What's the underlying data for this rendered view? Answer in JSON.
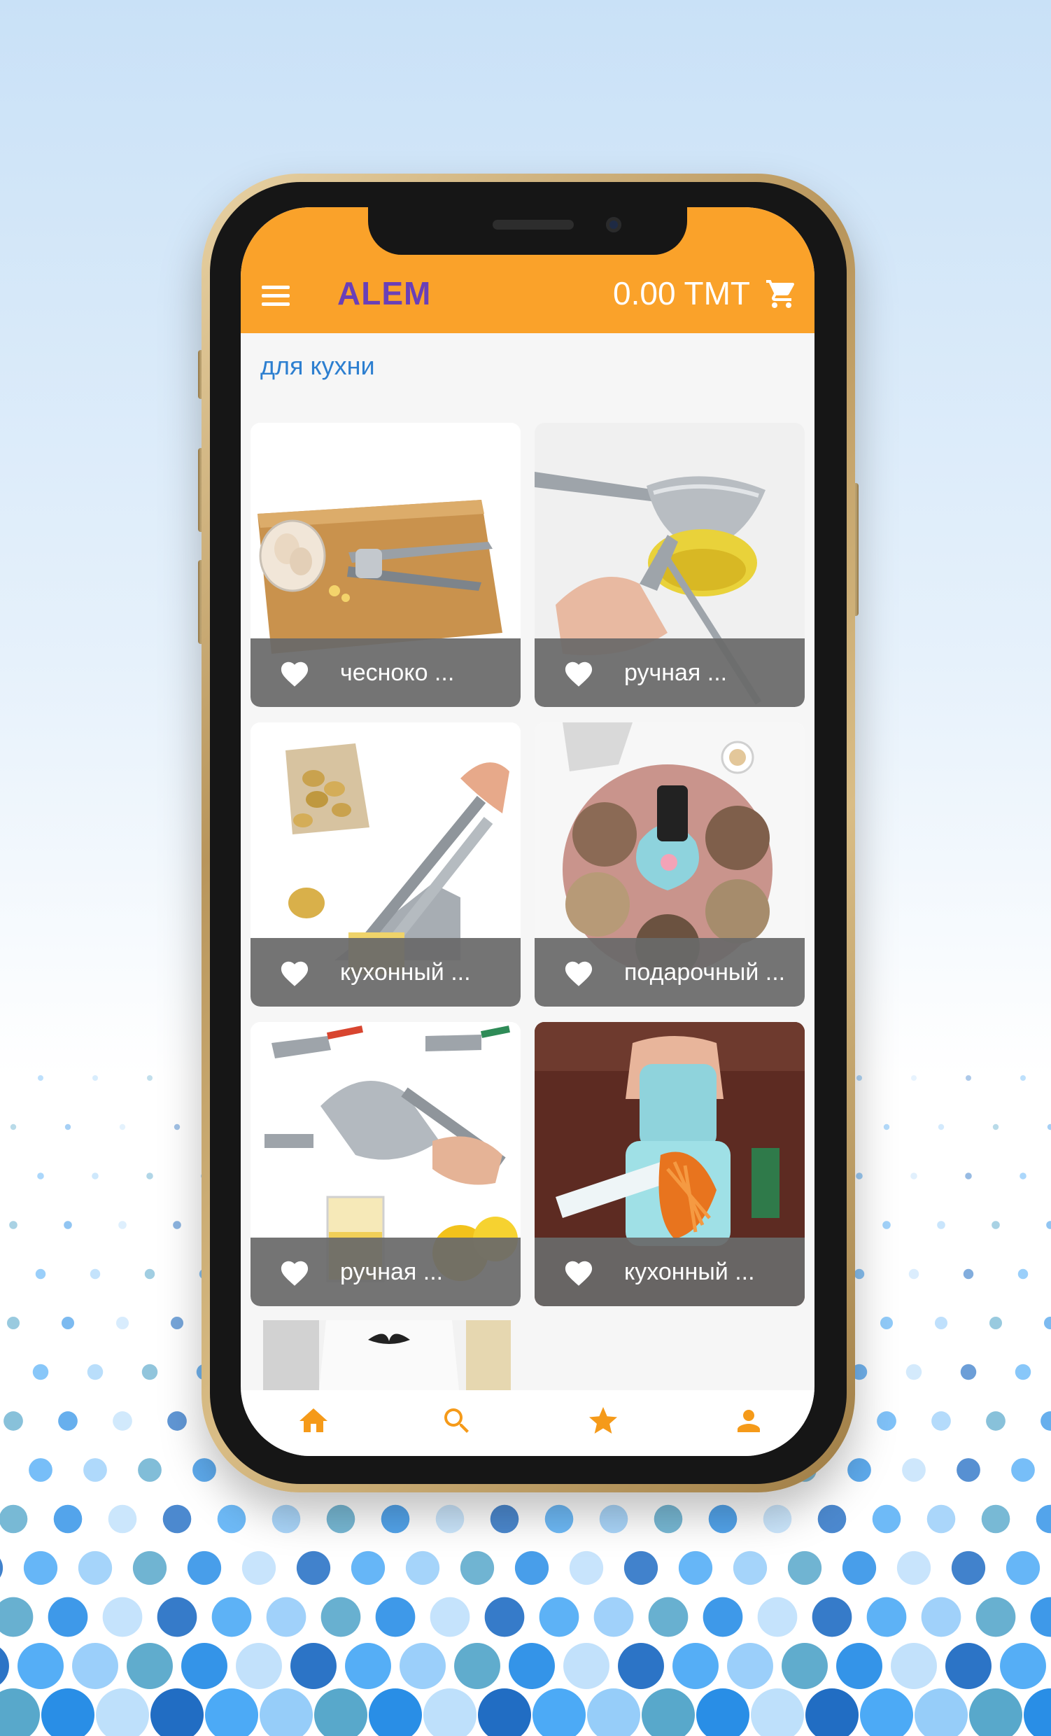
{
  "app": {
    "brand": "ALEM",
    "cart_total": "0.00 TMT",
    "category_title": "для кухни"
  },
  "products": [
    {
      "label": "чесноко ...",
      "image": "garlic-press-photo"
    },
    {
      "label": "ручная ...",
      "image": "citrus-squeezer-photo"
    },
    {
      "label": "кухонный ...",
      "image": "potato-cutter-photo"
    },
    {
      "label": "подарочный ...",
      "image": "flower-snack-box-photo"
    },
    {
      "label": "ручная ...",
      "image": "juice-press-photo"
    },
    {
      "label": "кухонный ...",
      "image": "rotary-grater-photo"
    }
  ],
  "partial_product_image": "apron-photo",
  "bottom_nav": [
    "home-icon",
    "search-icon",
    "favorites-star-icon",
    "profile-icon"
  ],
  "colors": {
    "accent": "#faa22a",
    "brand_text": "#6a3fb8",
    "category_text": "#2d7fd0",
    "card_overlay": "#696969",
    "dots": [
      "#1565c0",
      "#42a5f5",
      "#90caf9",
      "#4fa3c8",
      "#1e88e5",
      "#bbdefb"
    ]
  }
}
